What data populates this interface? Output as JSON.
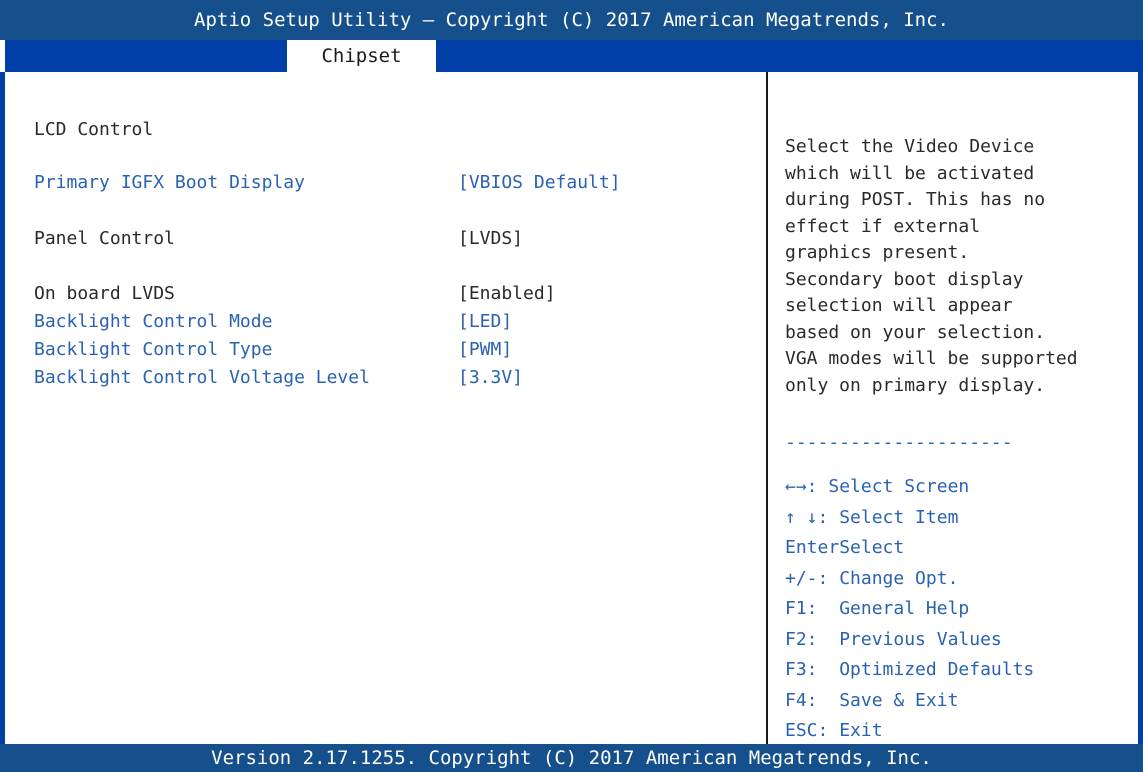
{
  "header": {
    "title": "Aptio Setup Utility – Copyright (C) 2017 American Megatrends, Inc."
  },
  "tabs": [
    {
      "label": "Chipset"
    }
  ],
  "settings": {
    "section_title": "LCD Control",
    "items": [
      {
        "label": "Primary IGFX Boot Display",
        "value": "[VBIOS Default]",
        "selectable": true
      },
      {
        "label": "Panel Control",
        "value": "[LVDS]",
        "selectable": false
      },
      {
        "label": "On board LVDS",
        "value": "[Enabled]",
        "selectable": false
      },
      {
        "label": "Backlight Control Mode",
        "value": "[LED]",
        "selectable": true
      },
      {
        "label": "Backlight Control Type",
        "value": "[PWM]",
        "selectable": true
      },
      {
        "label": "Backlight Control Voltage Level",
        "value": "[3.3V]",
        "selectable": true
      }
    ]
  },
  "help": {
    "lines": [
      "Select the Video Device",
      "which will be activated",
      "during POST. This has no",
      "effect if external",
      "graphics present.",
      "Secondary boot display",
      "selection will appear",
      "based on your selection.",
      "VGA modes will be supported",
      "only on primary display."
    ],
    "separator": "---------------------"
  },
  "keys": [
    {
      "key": "←→:",
      "desc": "Select Screen"
    },
    {
      "key": "↑ ↓:",
      "desc": "Select Item"
    },
    {
      "key": "Enter",
      "desc": "Select"
    },
    {
      "key": "+/-:",
      "desc": "Change Opt."
    },
    {
      "key": "F1:",
      "desc": "General Help"
    },
    {
      "key": "F2:",
      "desc": "Previous Values"
    },
    {
      "key": "F3:",
      "desc": "Optimized Defaults"
    },
    {
      "key": "F4:",
      "desc": "Save & Exit"
    },
    {
      "key": "ESC:",
      "desc": "Exit"
    }
  ],
  "footer": {
    "text": "Version 2.17.1255. Copyright (C) 2017 American Megatrends, Inc."
  },
  "colors": {
    "title_bg": "#16508c",
    "tab_bar": "#003fa8",
    "selectable_text": "#2a62b2",
    "static_text": "#2a2a2a",
    "background": "#ffffff"
  }
}
